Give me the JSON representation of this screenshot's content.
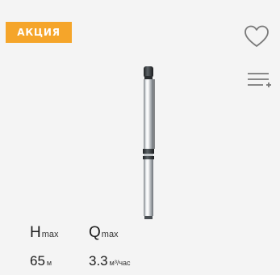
{
  "badge": {
    "label": "АКЦИЯ"
  },
  "icons": {
    "favorite": "heart-icon",
    "compare": "compare-list-icon"
  },
  "colors": {
    "badge": "#f5a52a",
    "background": "#f4f4f4",
    "icon": "#7a7a7a"
  },
  "specs": {
    "head": {
      "symbol": "H",
      "subscript": "max",
      "value": "65",
      "unit": "м"
    },
    "flow": {
      "symbol": "Q",
      "subscript": "max",
      "value": "3.3",
      "unit": "м³/час"
    }
  }
}
